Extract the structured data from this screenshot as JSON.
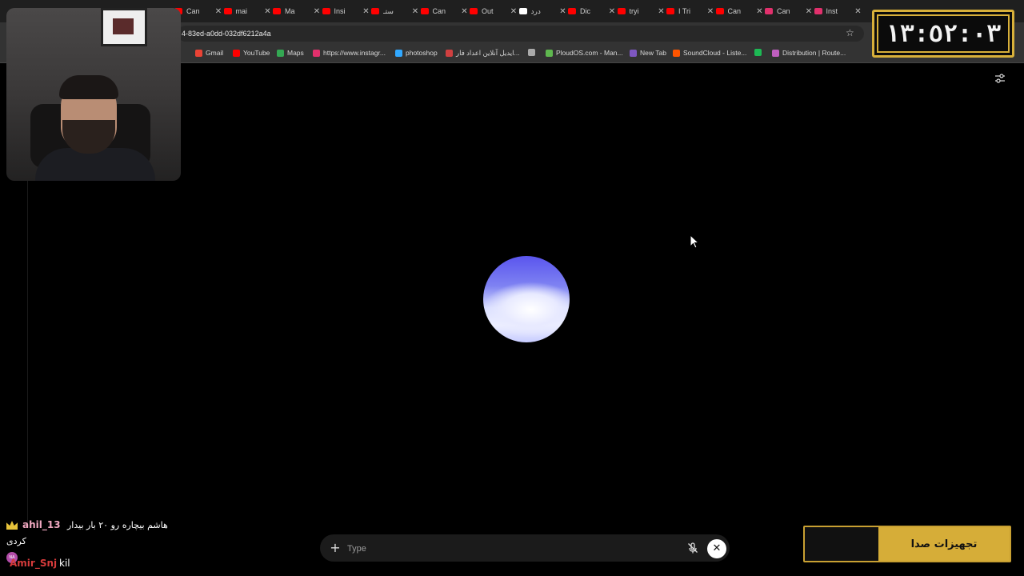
{
  "browser": {
    "tabs": [
      {
        "label": "Can",
        "color": "#ff0000"
      },
      {
        "label": "mai",
        "color": "#ff0000"
      },
      {
        "label": "Ma",
        "color": "#ff0000"
      },
      {
        "label": "Insi",
        "color": "#ff0000"
      },
      {
        "label": "ستـ",
        "color": "#ff0000"
      },
      {
        "label": "Can",
        "color": "#ff0000"
      },
      {
        "label": "Out",
        "color": "#ff0000"
      },
      {
        "label": "درد",
        "color": "#ffffff"
      },
      {
        "label": "Dic",
        "color": "#ff0000"
      },
      {
        "label": "tryi",
        "color": "#ff0000"
      },
      {
        "label": "I Tri",
        "color": "#ff0000"
      },
      {
        "label": "Can",
        "color": "#ff0000"
      },
      {
        "label": "Can",
        "color": "#e1306c"
      },
      {
        "label": "Inst",
        "color": "#e1306c"
      }
    ],
    "url": "4-83ed-a0dd-032df6212a4a",
    "bookmarks": [
      {
        "label": "Gmail",
        "color": "#ea4335"
      },
      {
        "label": "YouTube",
        "color": "#ff0000"
      },
      {
        "label": "Maps",
        "color": "#34a853"
      },
      {
        "label": "https://www.instagr...",
        "color": "#e1306c"
      },
      {
        "label": "photoshop",
        "color": "#31a8ff"
      },
      {
        "label": "ایدیل آنلاین اعداد فار...",
        "color": "#d04040"
      },
      {
        "label": "",
        "color": "#aaaaaa"
      },
      {
        "label": "PloudOS.com - Man...",
        "color": "#5fb84f"
      },
      {
        "label": "New Tab",
        "color": "#7e57c2"
      },
      {
        "label": "SoundCloud - Liste...",
        "color": "#ff5500"
      },
      {
        "label": "",
        "color": "#1db954"
      },
      {
        "label": "Distribution | Route...",
        "color": "#c05fc0"
      }
    ]
  },
  "overlay": {
    "clock": "١٣:٥٢:٠٣",
    "banner": "تجهیزات صدا"
  },
  "chat": {
    "msg1_user": "ahil_13",
    "msg1_text": "هاشم بیچاره رو ۲۰ بار بیدار",
    "msg1_text2": "کردی",
    "msg2_avatar": "NA",
    "msg2_user": "Amir_Snj",
    "msg2_text": "kil"
  },
  "composer": {
    "plus": "+",
    "placeholder": "Type",
    "close": "✕"
  },
  "colors": {
    "orb_top": "#5a55ee",
    "orb_bottom": "#eef0ff",
    "accent_gold": "#d6ad38"
  }
}
